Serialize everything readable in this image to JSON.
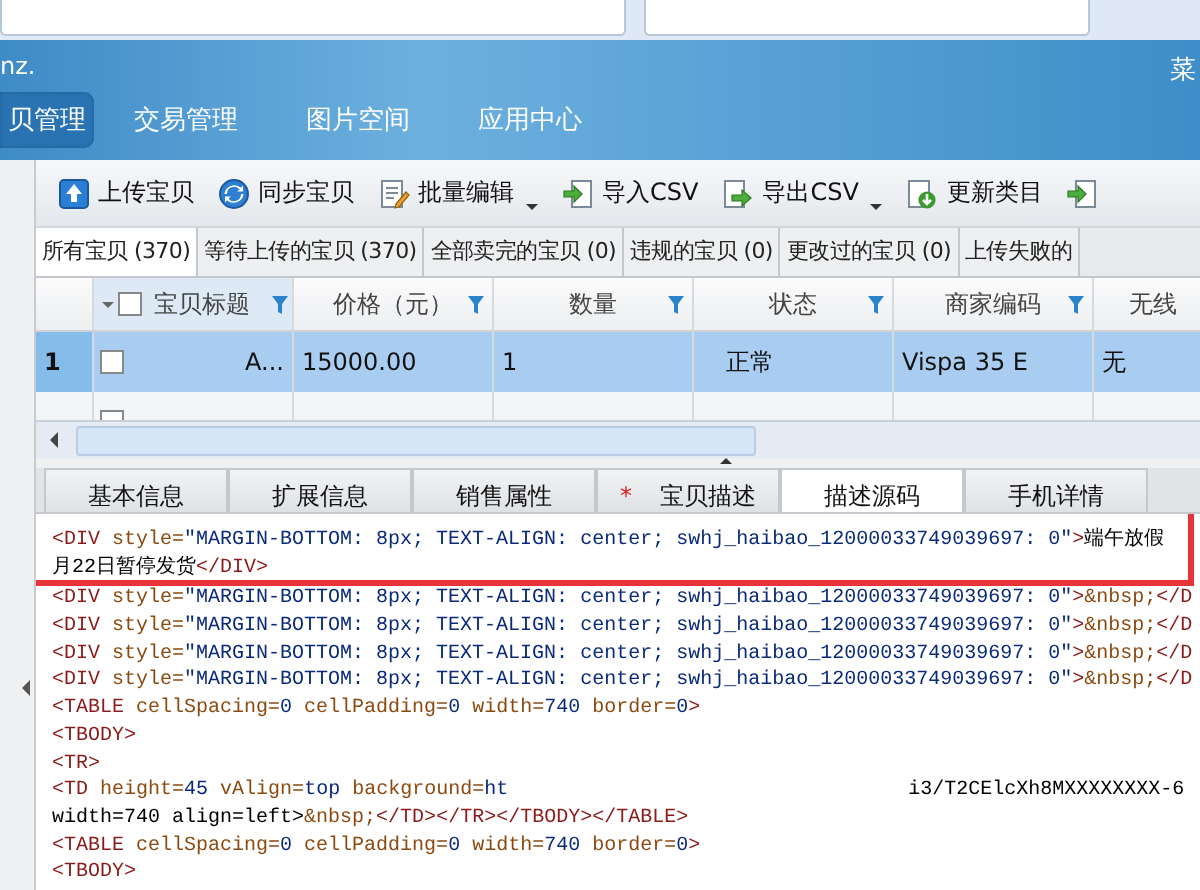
{
  "header": {
    "left_text": "nz.",
    "right_text": "菜"
  },
  "nav_tabs": [
    {
      "label": "贝管理",
      "selected": true
    },
    {
      "label": "交易管理",
      "selected": false
    },
    {
      "label": "图片空间",
      "selected": false
    },
    {
      "label": "应用中心",
      "selected": false
    }
  ],
  "toolbar": [
    {
      "label": "上传宝贝",
      "kind": "upload",
      "dropdown": false
    },
    {
      "label": "同步宝贝",
      "kind": "sync",
      "dropdown": false
    },
    {
      "label": "批量编辑",
      "kind": "edit",
      "dropdown": true
    },
    {
      "label": "导入CSV",
      "kind": "import",
      "dropdown": false
    },
    {
      "label": "导出CSV",
      "kind": "export",
      "dropdown": true
    },
    {
      "label": "更新类目",
      "kind": "update",
      "dropdown": false
    },
    {
      "kind": "import",
      "dropdown": false
    }
  ],
  "item_tabs": [
    {
      "label": "所有宝贝 (370)",
      "selected": true
    },
    {
      "label": "等待上传的宝贝 (370)",
      "selected": false
    },
    {
      "label": "全部卖完的宝贝 (0)",
      "selected": false
    },
    {
      "label": "违规的宝贝 (0)",
      "selected": false
    },
    {
      "label": "更改过的宝贝 (0)",
      "selected": false
    },
    {
      "label": "上传失败的",
      "selected": false
    }
  ],
  "grid": {
    "select_all": {
      "checked": false
    },
    "columns": [
      {
        "label": "宝贝标题",
        "filter": true
      },
      {
        "label": "价格（元）",
        "filter": true
      },
      {
        "label": "数量",
        "filter": true
      },
      {
        "label": "状态",
        "filter": true
      },
      {
        "label": "商家编码",
        "filter": true
      },
      {
        "label": "无线",
        "filter": false
      }
    ],
    "rows": [
      {
        "number": "1",
        "selected": true,
        "checked": false,
        "cells": [
          "A...",
          "15000.00",
          "1",
          "正常",
          "Vispa 35 E",
          "无"
        ]
      },
      {
        "selected": false,
        "checked": false
      }
    ]
  },
  "detail_tabs": [
    {
      "label": "基本信息",
      "selected": false,
      "required": false
    },
    {
      "label": "扩展信息",
      "selected": false,
      "required": false
    },
    {
      "label": "销售属性",
      "selected": false,
      "required": false
    },
    {
      "label": "宝贝描述",
      "selected": false,
      "required": false,
      "marker": "*"
    },
    {
      "label": "描述源码",
      "selected": true,
      "required": false
    },
    {
      "label": "手机详情",
      "selected": false,
      "required": false
    }
  ],
  "code_lines": [
    {
      "text": "<DIV style=\"MARGIN-BOTTOM: 8px; TEXT-ALIGN: center; swhj_haibao_12000033749039697: 0\">端午放假",
      "highlighted": true
    },
    {
      "text": "月22日暂停发货</DIV>",
      "highlighted": true
    },
    {
      "text": "<DIV style=\"MARGIN-BOTTOM: 8px; TEXT-ALIGN: center; swhj_haibao_12000033749039697: 0\">&nbsp;</D"
    },
    {
      "text": "<DIV style=\"MARGIN-BOTTOM: 8px; TEXT-ALIGN: center; swhj_haibao_12000033749039697: 0\">&nbsp;</D"
    },
    {
      "text": "<DIV style=\"MARGIN-BOTTOM: 8px; TEXT-ALIGN: center; swhj_haibao_12000033749039697: 0\">&nbsp;</D"
    },
    {
      "text": "<DIV style=\"MARGIN-BOTTOM: 8px; TEXT-ALIGN: center; swhj_haibao_12000033749039697: 0\">&nbsp;</D"
    },
    {
      "text": "<TABLE cellSpacing=0 cellPadding=0 width=740 border=0>"
    },
    {
      "text": "<TBODY>"
    },
    {
      "text": "<TR>"
    },
    {
      "text": "<TD height=45 vAlign=top background=ht",
      "after_gap": "i3/T2CElcXh8MXXXXXXXX-6"
    },
    {
      "text": "width=740 align=left>&nbsp;</TD></TR></TBODY></TABLE>"
    },
    {
      "text": "<TABLE cellSpacing=0 cellPadding=0 width=740 border=0>"
    },
    {
      "text": "<TBODY>"
    }
  ]
}
